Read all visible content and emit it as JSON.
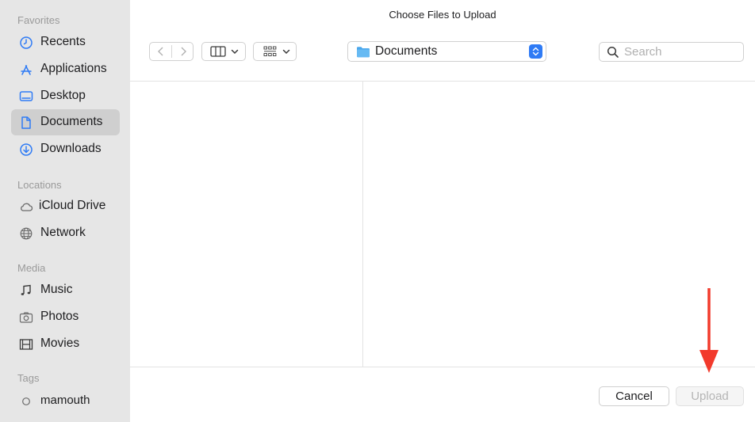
{
  "window": {
    "title": "Choose Files to Upload"
  },
  "sidebar": {
    "favorites_title": "Favorites",
    "favorites": [
      {
        "label": "Recents",
        "icon": "clock-icon"
      },
      {
        "label": "Applications",
        "icon": "applications-icon"
      },
      {
        "label": "Desktop",
        "icon": "desktop-icon"
      },
      {
        "label": "Documents",
        "icon": "document-icon",
        "selected": true
      },
      {
        "label": "Downloads",
        "icon": "download-icon"
      }
    ],
    "locations_title": "Locations",
    "locations": [
      {
        "label": "iCloud Drive",
        "icon": "cloud-icon"
      },
      {
        "label": "Network",
        "icon": "globe-icon"
      }
    ],
    "media_title": "Media",
    "media": [
      {
        "label": "Music",
        "icon": "music-note-icon"
      },
      {
        "label": "Photos",
        "icon": "camera-icon"
      },
      {
        "label": "Movies",
        "icon": "film-icon"
      }
    ],
    "tags_title": "Tags",
    "tags": [
      {
        "label": "mamouth",
        "icon": "tag-circle-icon"
      }
    ]
  },
  "toolbar": {
    "back_icon": "chevron-left-icon",
    "forward_icon": "chevron-right-icon",
    "view_mode_icon": "columns-view-icon",
    "group_icon": "group-grid-icon",
    "location": "Documents",
    "search_placeholder": "Search"
  },
  "footer": {
    "cancel_label": "Cancel",
    "upload_label": "Upload"
  },
  "colors": {
    "sidebar_bg": "#e6e6e6",
    "selected_bg": "#cfcfcf",
    "accent_blue": "#2f7bf5",
    "arrow_red": "#f23a2c"
  }
}
